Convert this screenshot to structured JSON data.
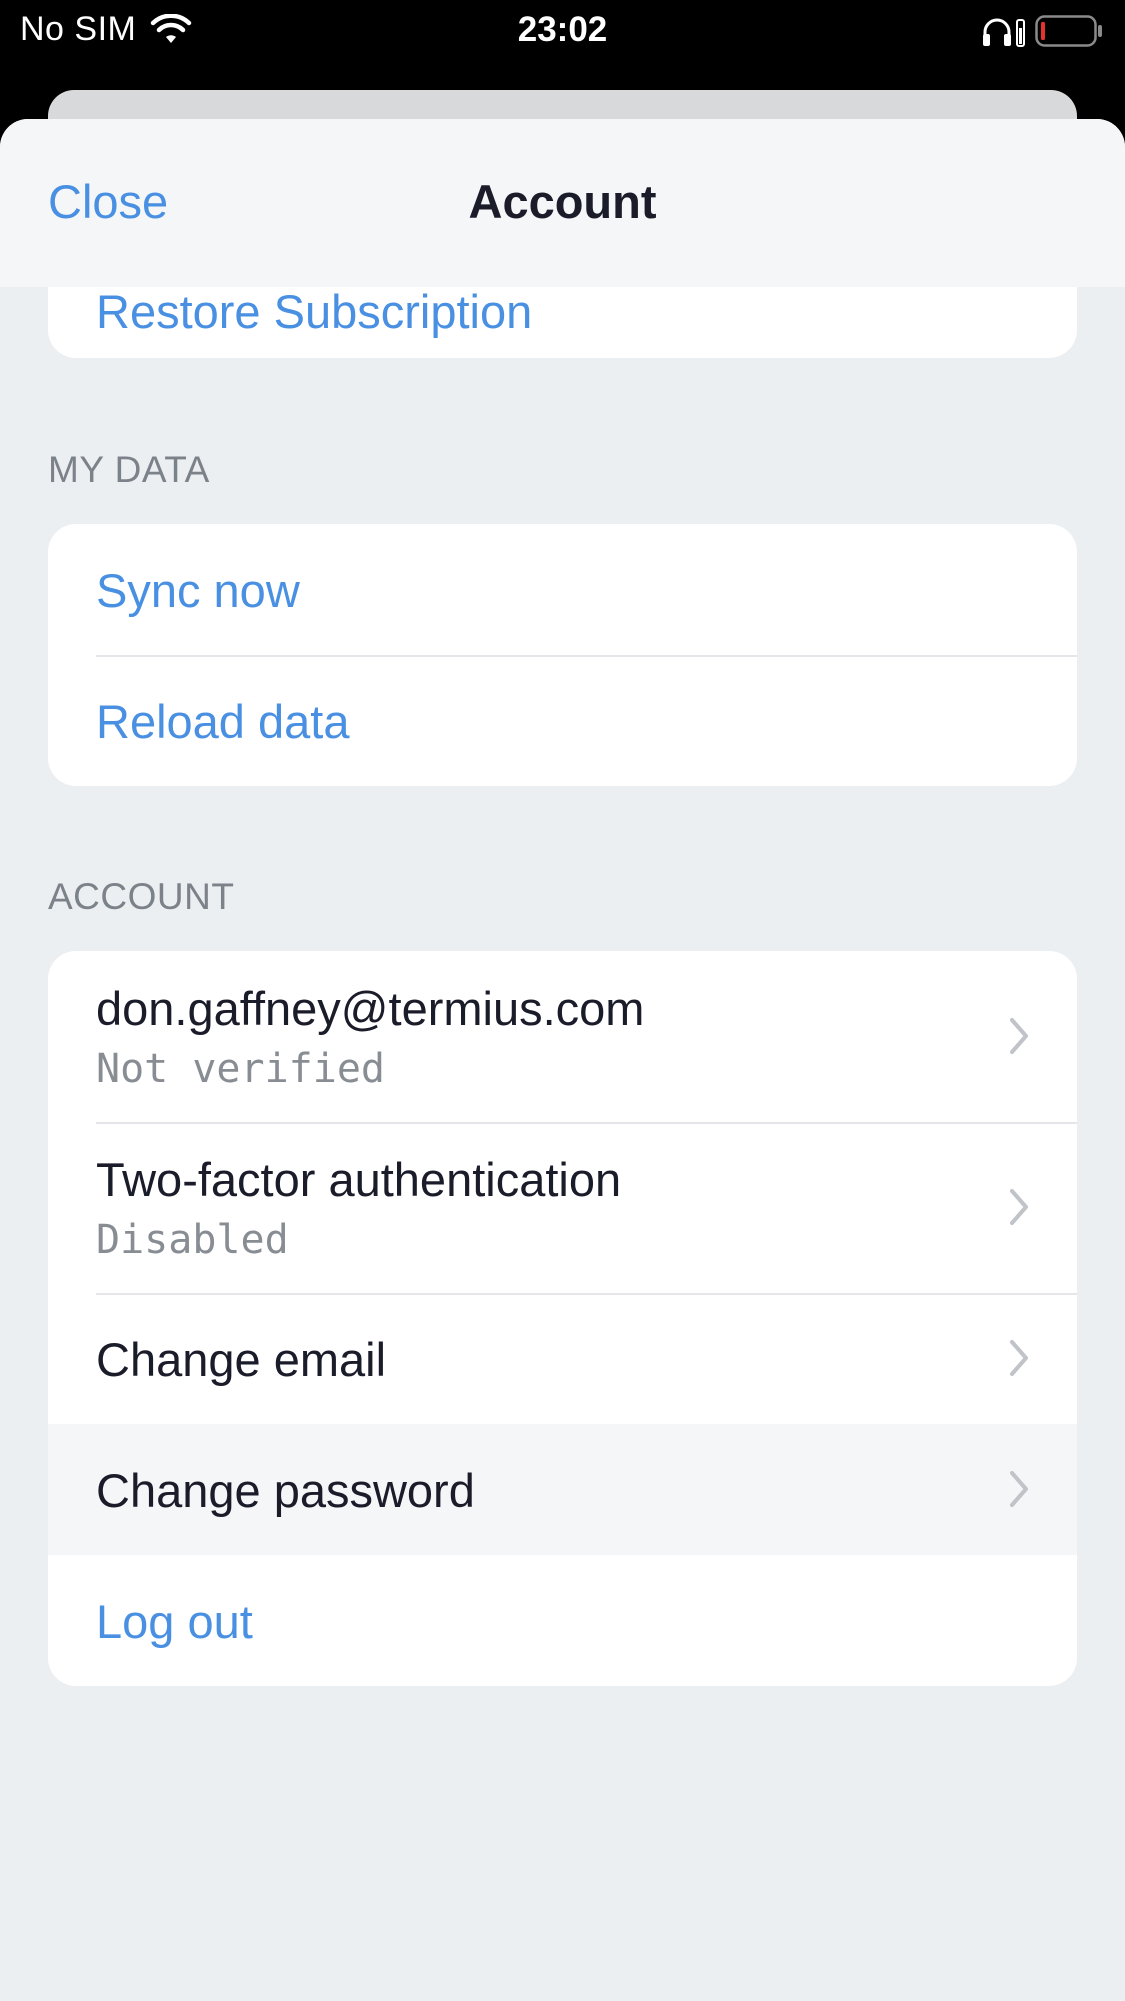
{
  "status_bar": {
    "carrier": "No SIM",
    "time": "23:02",
    "icons": [
      "wifi-icon",
      "headphones-icon",
      "battery-icon"
    ]
  },
  "nav": {
    "close_label": "Close",
    "title": "Account"
  },
  "restore_group": {
    "restore_label": "Restore Subscription"
  },
  "my_data": {
    "header": "MY DATA",
    "sync_label": "Sync now",
    "reload_label": "Reload data"
  },
  "account": {
    "header": "ACCOUNT",
    "email": "don.gaffney@termius.com",
    "email_status": "Not verified",
    "two_factor_label": "Two-factor authentication",
    "two_factor_status": "Disabled",
    "change_email_label": "Change email",
    "change_password_label": "Change password",
    "logout_label": "Log out"
  },
  "colors": {
    "accent": "#4a90e2",
    "text": "#1b1c2a",
    "secondary": "#878d93",
    "background": "#ebeff1",
    "low_battery": "#e5322d"
  }
}
